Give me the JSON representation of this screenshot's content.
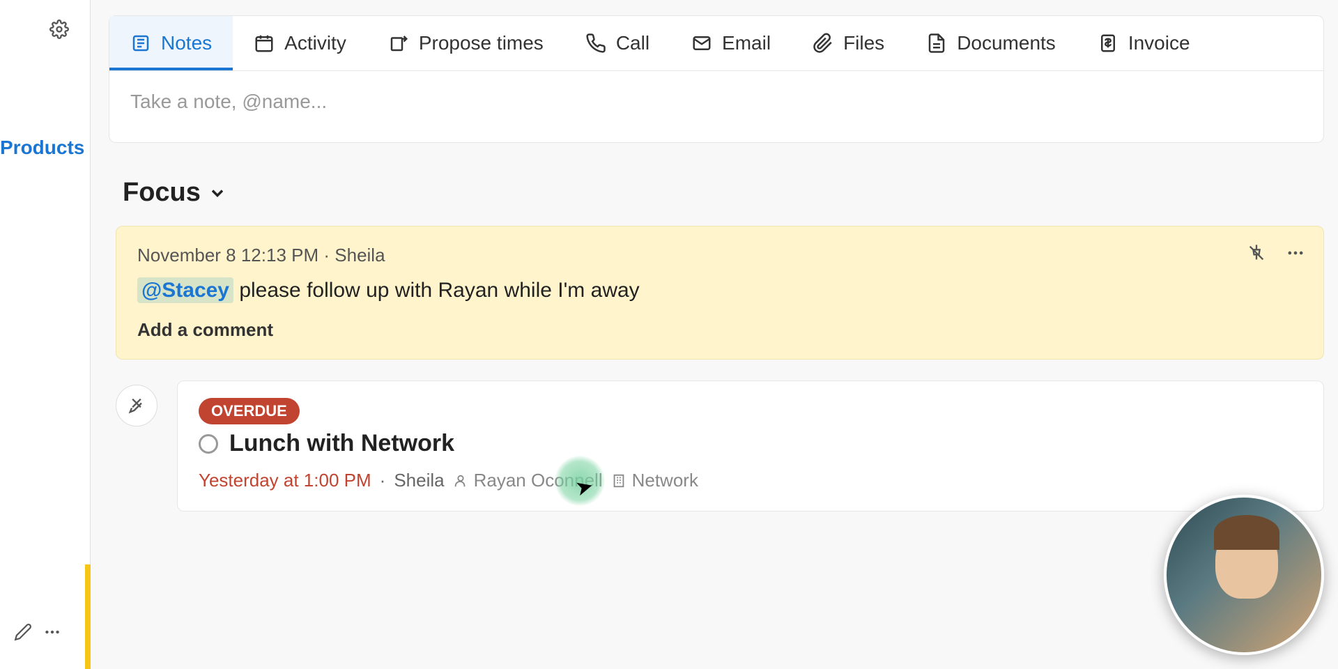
{
  "sidebar": {
    "products_label": "Products"
  },
  "tabs": [
    {
      "label": "Notes",
      "icon": "note"
    },
    {
      "label": "Activity",
      "icon": "calendar"
    },
    {
      "label": "Propose times",
      "icon": "propose"
    },
    {
      "label": "Call",
      "icon": "phone"
    },
    {
      "label": "Email",
      "icon": "mail"
    },
    {
      "label": "Files",
      "icon": "paperclip"
    },
    {
      "label": "Documents",
      "icon": "document"
    },
    {
      "label": "Invoice",
      "icon": "invoice"
    }
  ],
  "note_input": {
    "placeholder": "Take a note, @name..."
  },
  "focus": {
    "heading": "Focus"
  },
  "pinned_note": {
    "timestamp": "November 8 12:13 PM",
    "author": "Sheila",
    "mention": "@Stacey",
    "body_rest": " please follow up with Rayan while I'm away",
    "add_comment": "Add a comment"
  },
  "task": {
    "badge": "OVERDUE",
    "title": "Lunch with Network",
    "date": "Yesterday at 1:00 PM",
    "owner": "Sheila",
    "person": "Rayan Oconnell",
    "org": "Network"
  }
}
